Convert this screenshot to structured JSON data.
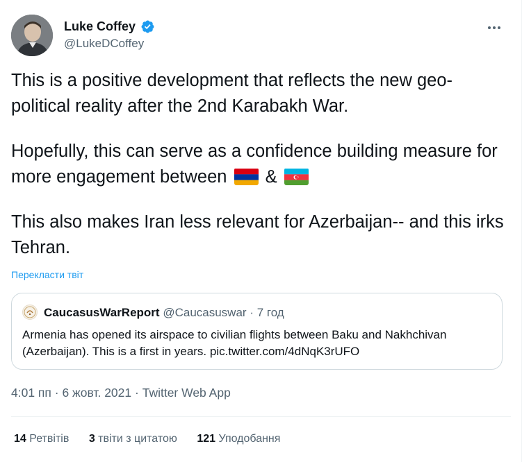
{
  "author": {
    "display_name": "Luke Coffey",
    "handle": "@LukeDCoffey",
    "verified": true,
    "avatar_icon": "profile-photo"
  },
  "menu": {
    "more_icon": "more-horizontal-icon"
  },
  "tweet": {
    "paragraph1": "This is a positive development that reflects the new geo-political reality after the 2nd Karabakh War.",
    "paragraph2_before_flags": "Hopefully, this can serve as a confidence building measure for more engagement between",
    "paragraph2_ampersand": "&",
    "flag1": "armenia-flag-emoji",
    "flag2": "azerbaijan-flag-emoji",
    "paragraph3": "This also makes Iran less relevant for Azerbaijan-- and this irks Tehran.",
    "translate_label": "Перекласти твіт"
  },
  "quote": {
    "display_name": "CaucasusWarReport",
    "handle": "@Caucasuswar",
    "separator": "·",
    "time": "7 год",
    "text": "Armenia has opened its airspace to civilian flights between Baku and Nakhchivan (Azerbaijan). This is a first in years. pic.twitter.com/4dNqK3rUFO"
  },
  "meta": {
    "time": "4:01 пп",
    "separator1": "·",
    "date": "6 жовт. 2021",
    "separator2": "·",
    "source": "Twitter Web App"
  },
  "stats": {
    "retweets_count": "14",
    "retweets_label": "Ретвітів",
    "quotes_count": "3",
    "quotes_label": "твіти з цитатою",
    "likes_count": "121",
    "likes_label": "Уподобання"
  },
  "colors": {
    "accent": "#1d9bf0",
    "text_primary": "#0f1419",
    "text_secondary": "#536471",
    "border": "#cfd9de"
  }
}
